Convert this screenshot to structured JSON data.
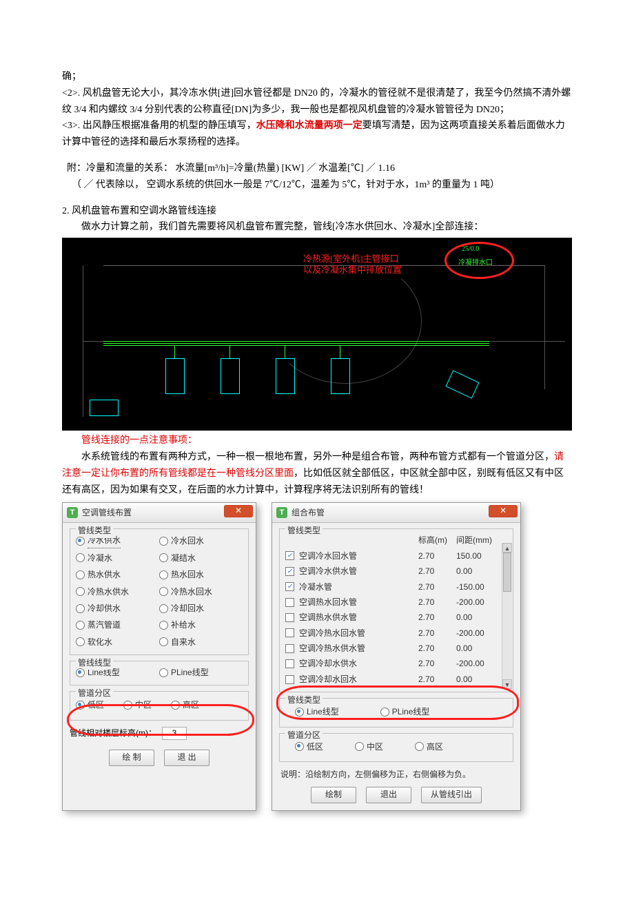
{
  "para": {
    "l1": "确；",
    "l2": "<2>. 风机盘管无论大小，其冷冻水供[进]回水管径都是 DN20 的，冷凝水的管径就不是很清楚了，我至今仍然搞不清外螺纹 3/4 和内螺纹 3/4 分别代表的公称直径[DN]为多少，我一般也是都视风机盘管的冷凝水管管径为 DN20；",
    "l3a": "<3>. 出风静压根据准备用的机型的静压填写，",
    "l3b": "水压降和水流量两项一定",
    "l3c": "要填写清楚，因为这两项直接关系着后面做水力计算中管径的选择和最后水泵扬程的选择。",
    "l4": "附：冷量和流量的关系：  水流量[m³/h]=冷量(热量) [KW] ／ 水温差[℃] ／ 1.16",
    "l5": "（ ／ 代表除以，  空调水系统的供回水一般是 7℃/12℃，温差为 5℃，针对于水，1m³ 的重量为 1 吨）",
    "h2": "2. 风机盘管布置和空调水路管线连接",
    "l6": "做水力计算之前，我们首先需要将风机盘管布置完整，管线[冷冻水供回水、冷凝水]全部连接：",
    "l7": "管线连接的一点注意事项：",
    "l8a": "水系统管线的布置有两种方式，一种一根一根地布置，另外一种是组合布管，两种布管方式都有一个管道分区，",
    "l8b": "请注意一定让你布置的所有管线都是在一种管线分区里面",
    "l8c": "，比如低区就全部低区，中区就全部中区，别既有低区又有中区还有高区，因为如果有交叉，在后面的水力计算中，计算程序将无法识别所有的管线！"
  },
  "cad": {
    "red1": "冷热源[室外机]主管接口",
    "red2": "以及冷凝水集中排放位置",
    "tag1": "25/0.0",
    "tag2": "冷凝排水口"
  },
  "dlg1": {
    "title": "空调管线布置",
    "g1": "管线类型",
    "r1": "冷水供水",
    "r2": "冷水回水",
    "r3": "冷凝水",
    "r4": "凝结水",
    "r5": "热水供水",
    "r6": "热水回水",
    "r7": "冷热水供水",
    "r8": "冷热水回水",
    "r9": "冷却供水",
    "r10": "冷却回水",
    "r11": "蒸汽管道",
    "r12": "补给水",
    "r13": "软化水",
    "r14": "自来水",
    "g2": "管线线型",
    "lt1": "Line线型",
    "lt2": "PLine线型",
    "g3": "管道分区",
    "z1": "低区",
    "z2": "中区",
    "z3": "高区",
    "hgt_label": "管线相对楼层标高(m)：",
    "hgt_val": "3",
    "b1": "绘 制",
    "b2": "退 出"
  },
  "dlg2": {
    "title": "组合布管",
    "g1": "管线类型",
    "col_h": "标高(m)",
    "col_d": "间距(mm)",
    "rows": [
      {
        "c": true,
        "n": "空调冷水回水管",
        "h": "2.70",
        "d": "150.00"
      },
      {
        "c": true,
        "n": "空调冷水供水管",
        "h": "2.70",
        "d": "0.00"
      },
      {
        "c": true,
        "n": "冷凝水管",
        "h": "2.70",
        "d": "-150.00"
      },
      {
        "c": false,
        "n": "空调热水回水管",
        "h": "2.70",
        "d": "-200.00"
      },
      {
        "c": false,
        "n": "空调热水供水管",
        "h": "2.70",
        "d": "0.00"
      },
      {
        "c": false,
        "n": "空调冷热水回水管",
        "h": "2.70",
        "d": "-200.00"
      },
      {
        "c": false,
        "n": "空调冷热水供水管",
        "h": "2.70",
        "d": "0.00"
      },
      {
        "c": false,
        "n": "空调冷却水供水",
        "h": "2.70",
        "d": "-200.00"
      },
      {
        "c": false,
        "n": "空调冷却水回水",
        "h": "2.70",
        "d": "0.00"
      }
    ],
    "g2": "管线类型",
    "lt1": "Line线型",
    "lt2": "PLine线型",
    "g3": "管道分区",
    "z1": "低区",
    "z2": "中区",
    "z3": "高区",
    "hint": "说明：沿绘制方向，左侧偏移为正，右侧偏移为负。",
    "b1": "绘制",
    "b2": "退出",
    "b3": "从管线引出"
  }
}
